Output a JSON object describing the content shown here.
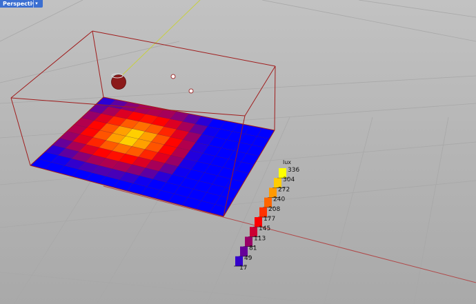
{
  "viewport": {
    "label": "Perspective",
    "menu_icon": "chevron-down-icon"
  },
  "analysis_grid": {
    "rows": 10,
    "cols": 14,
    "peak_value": 336,
    "min_value": 17
  },
  "legend": {
    "title": "lux",
    "values": [
      "336",
      "304",
      "272",
      "240",
      "208",
      "177",
      "145",
      "113",
      "81",
      "49",
      "17"
    ],
    "colors": [
      "#ffff00",
      "#ffcc00",
      "#ff9900",
      "#ff6600",
      "#ff3300",
      "#ff0000",
      "#cc0033",
      "#990066",
      "#660099",
      "#3300cc",
      "#0000ff"
    ]
  },
  "colors": {
    "box_edge": "#a01c1c",
    "grid_axis_red": "#b04848",
    "grid_axis_green": "#c8d040",
    "grid_line": "#a8a8a8",
    "sun": "#8b1a1a"
  }
}
